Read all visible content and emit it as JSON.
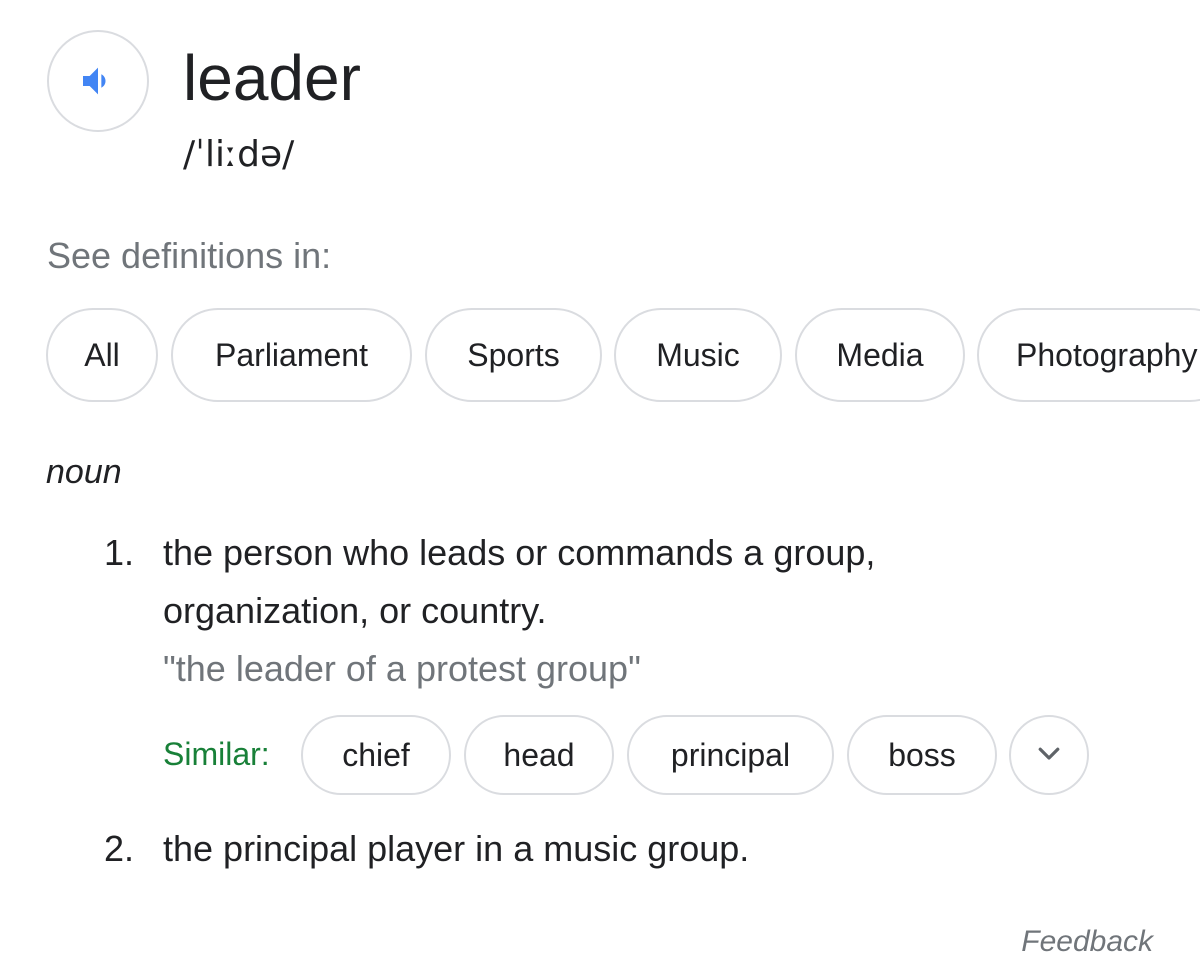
{
  "entry": {
    "word": "leader",
    "phonetic": "/ˈliːdə/",
    "speaker_icon": "speaker-volume-icon"
  },
  "see_definitions": {
    "label": "See definitions in:",
    "chips": [
      "All",
      "Parliament",
      "Sports",
      "Music",
      "Media",
      "Photography"
    ]
  },
  "part_of_speech": "noun",
  "definitions": [
    {
      "number": "1.",
      "text": "the person who leads or commands a group, organization, or country.",
      "example": "\"the leader of a protest group\"",
      "similar_label": "Similar:",
      "similar": [
        "chief",
        "head",
        "principal",
        "boss"
      ],
      "expand_icon": "chevron-down-icon"
    },
    {
      "number": "2.",
      "text": "the principal player in a music group."
    }
  ],
  "feedback_label": "Feedback",
  "colors": {
    "speaker_blue": "#4285f4",
    "similar_green": "#188038",
    "muted_gray": "#70757a",
    "chip_border": "#dadce0"
  }
}
